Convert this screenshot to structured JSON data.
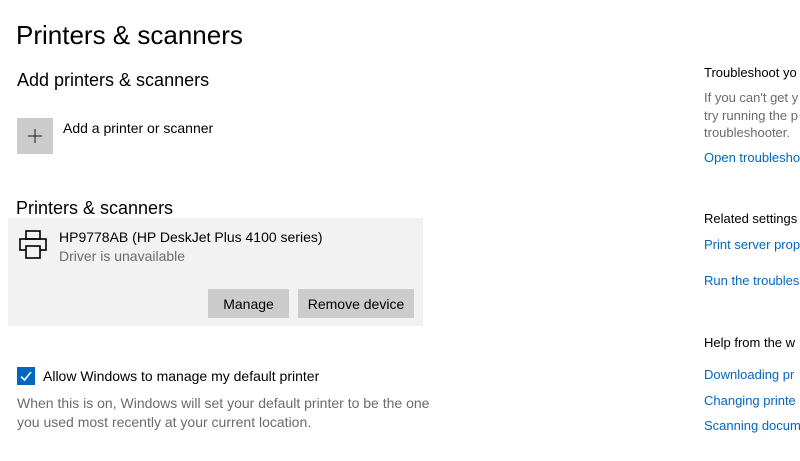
{
  "page": {
    "title": "Printers & scanners"
  },
  "add_section": {
    "title": "Add printers & scanners",
    "add_label": "Add a printer or scanner"
  },
  "devices_section": {
    "title": "Printers & scanners",
    "devices": [
      {
        "name": "HP9778AB (HP DeskJet Plus 4100 series)",
        "status": "Driver is unavailable",
        "manage_label": "Manage",
        "remove_label": "Remove device"
      }
    ]
  },
  "default_printer": {
    "checked": true,
    "label": "Allow Windows to manage my default printer",
    "description_line1": "When this is on, Windows will set your default printer to be the one",
    "description_line2": "you used most recently at your current location."
  },
  "sidebar": {
    "troubleshoot": {
      "title": "Troubleshoot yo",
      "text_line1": "If you can't get y",
      "text_line2": "try running the p",
      "text_line3": "troubleshooter.",
      "link": "Open troublesho"
    },
    "related": {
      "title": "Related settings",
      "link1": "Print server prop",
      "link2": "Run the troubles"
    },
    "help": {
      "title": "Help from the w",
      "link1": "Downloading pr",
      "link2": "Changing printe",
      "link3": "Scanning docum"
    }
  },
  "colors": {
    "accent": "#0067c0",
    "card_bg": "#f2f2f2",
    "button_bg": "#cccccc",
    "secondary_text": "#6b6b6b"
  }
}
